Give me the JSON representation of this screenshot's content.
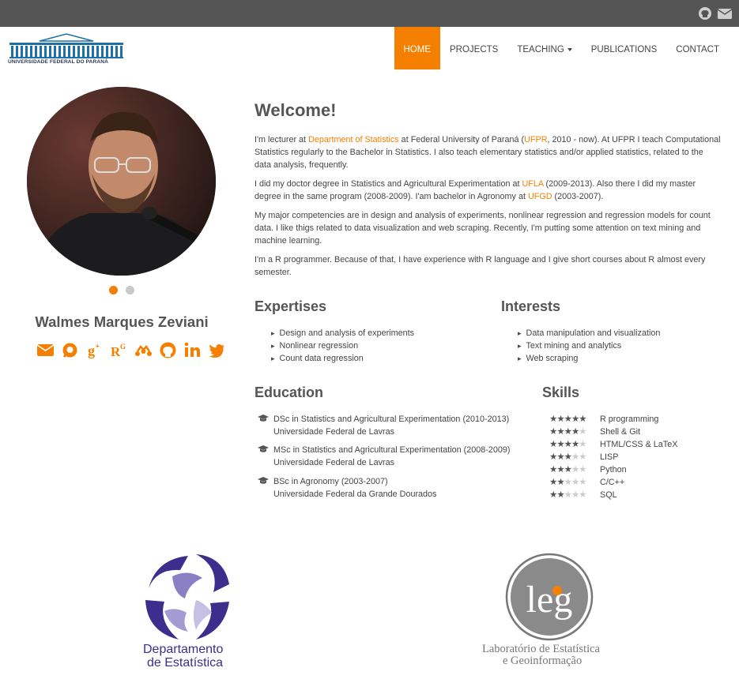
{
  "topbar": {
    "icons": [
      "github-icon",
      "envelope-icon"
    ]
  },
  "brand": {
    "logo_text": "UNIVERSIDADE FEDERAL DO PARANÁ"
  },
  "nav": {
    "items": [
      {
        "label": "HOME",
        "active": true
      },
      {
        "label": "PROJECTS"
      },
      {
        "label": "TEACHING"
      },
      {
        "label": "PUBLICATIONS"
      },
      {
        "label": "CONTACT"
      }
    ]
  },
  "profile": {
    "name": "Walmes Marques Zeviani",
    "social_icons": [
      "envelope-icon",
      "lattes-icon",
      "google-scholar-icon",
      "researchgate-icon",
      "mendeley-icon",
      "github-icon",
      "linkedin-icon",
      "twitter-icon"
    ],
    "carousel_dots": 2
  },
  "welcome": {
    "title": "Welcome!",
    "p1": {
      "a": "I'm lecturer at ",
      "b": "Department of Statistics",
      "c": " at Federal University of Paraná (",
      "d": "UFPR",
      "e": ", 2010 - now). At UFPR I teach Computational Statistics regularly to the Bachelor in Statistics. I also teach elementary statistics and/or applied statistics, related to the data analysis, frequently."
    },
    "p2": {
      "a": "I did my doctor degree in Statistics and Agricultural Experimentation at ",
      "b": "UFLA",
      "c": " (2009-2013). Also there I did my master degree in the same program (2008-2009). I'am bachelor in Agronomy at ",
      "d": "UFGD",
      "e": " (2003-2007)."
    },
    "p3": "My major competencies are in design and analysis of experiments, nonlinear regression and regression models for count data. I like thigs related to data visualization and web scraping. Recently, I'm putting some attention on text mining and machine learning.",
    "p4": "I'm a R programmer. Because of that, I have experience with R language and I give short courses about R almost every semester."
  },
  "expertises": {
    "title": "Expertises",
    "items": [
      "Design and analysis of experiments",
      "Nonlinear regression",
      "Count data regression"
    ]
  },
  "interests": {
    "title": "Interests",
    "items": [
      "Data manipulation and visualization",
      "Text mining and analytics",
      "Web scraping"
    ]
  },
  "education": {
    "title": "Education",
    "items": [
      {
        "degree": "DSc in Statistics and Agricultural Experimentation (2010-2013)",
        "school": "Universidade Federal de Lavras"
      },
      {
        "degree": "MSc in Statistics and Agricultural Experimentation (2008-2009)",
        "school": "Universidade Federal de Lavras"
      },
      {
        "degree": "BSc in Agronomy (2003-2007)",
        "school": "Universidade Federal da Grande Dourados"
      }
    ]
  },
  "skills": {
    "title": "Skills",
    "items": [
      {
        "name": "R programming",
        "stars": 5
      },
      {
        "name": "Shell & Git",
        "stars": 4
      },
      {
        "name": "HTML/CSS & LaTeX",
        "stars": 4
      },
      {
        "name": "LISP",
        "stars": 3
      },
      {
        "name": "Python",
        "stars": 3
      },
      {
        "name": "C/C++",
        "stars": 2
      },
      {
        "name": "SQL",
        "stars": 2
      }
    ]
  },
  "footer_logos": {
    "dept_line1": "Departamento",
    "dept_line2": "de Estatística",
    "leg_mark": "leg",
    "leg_line1": "Laboratório de Estatística",
    "leg_line2": "e Geoinformação"
  },
  "colors": {
    "accent": "#f47f00",
    "topbar": "#555555",
    "heading": "#555555",
    "text": "#444444"
  }
}
